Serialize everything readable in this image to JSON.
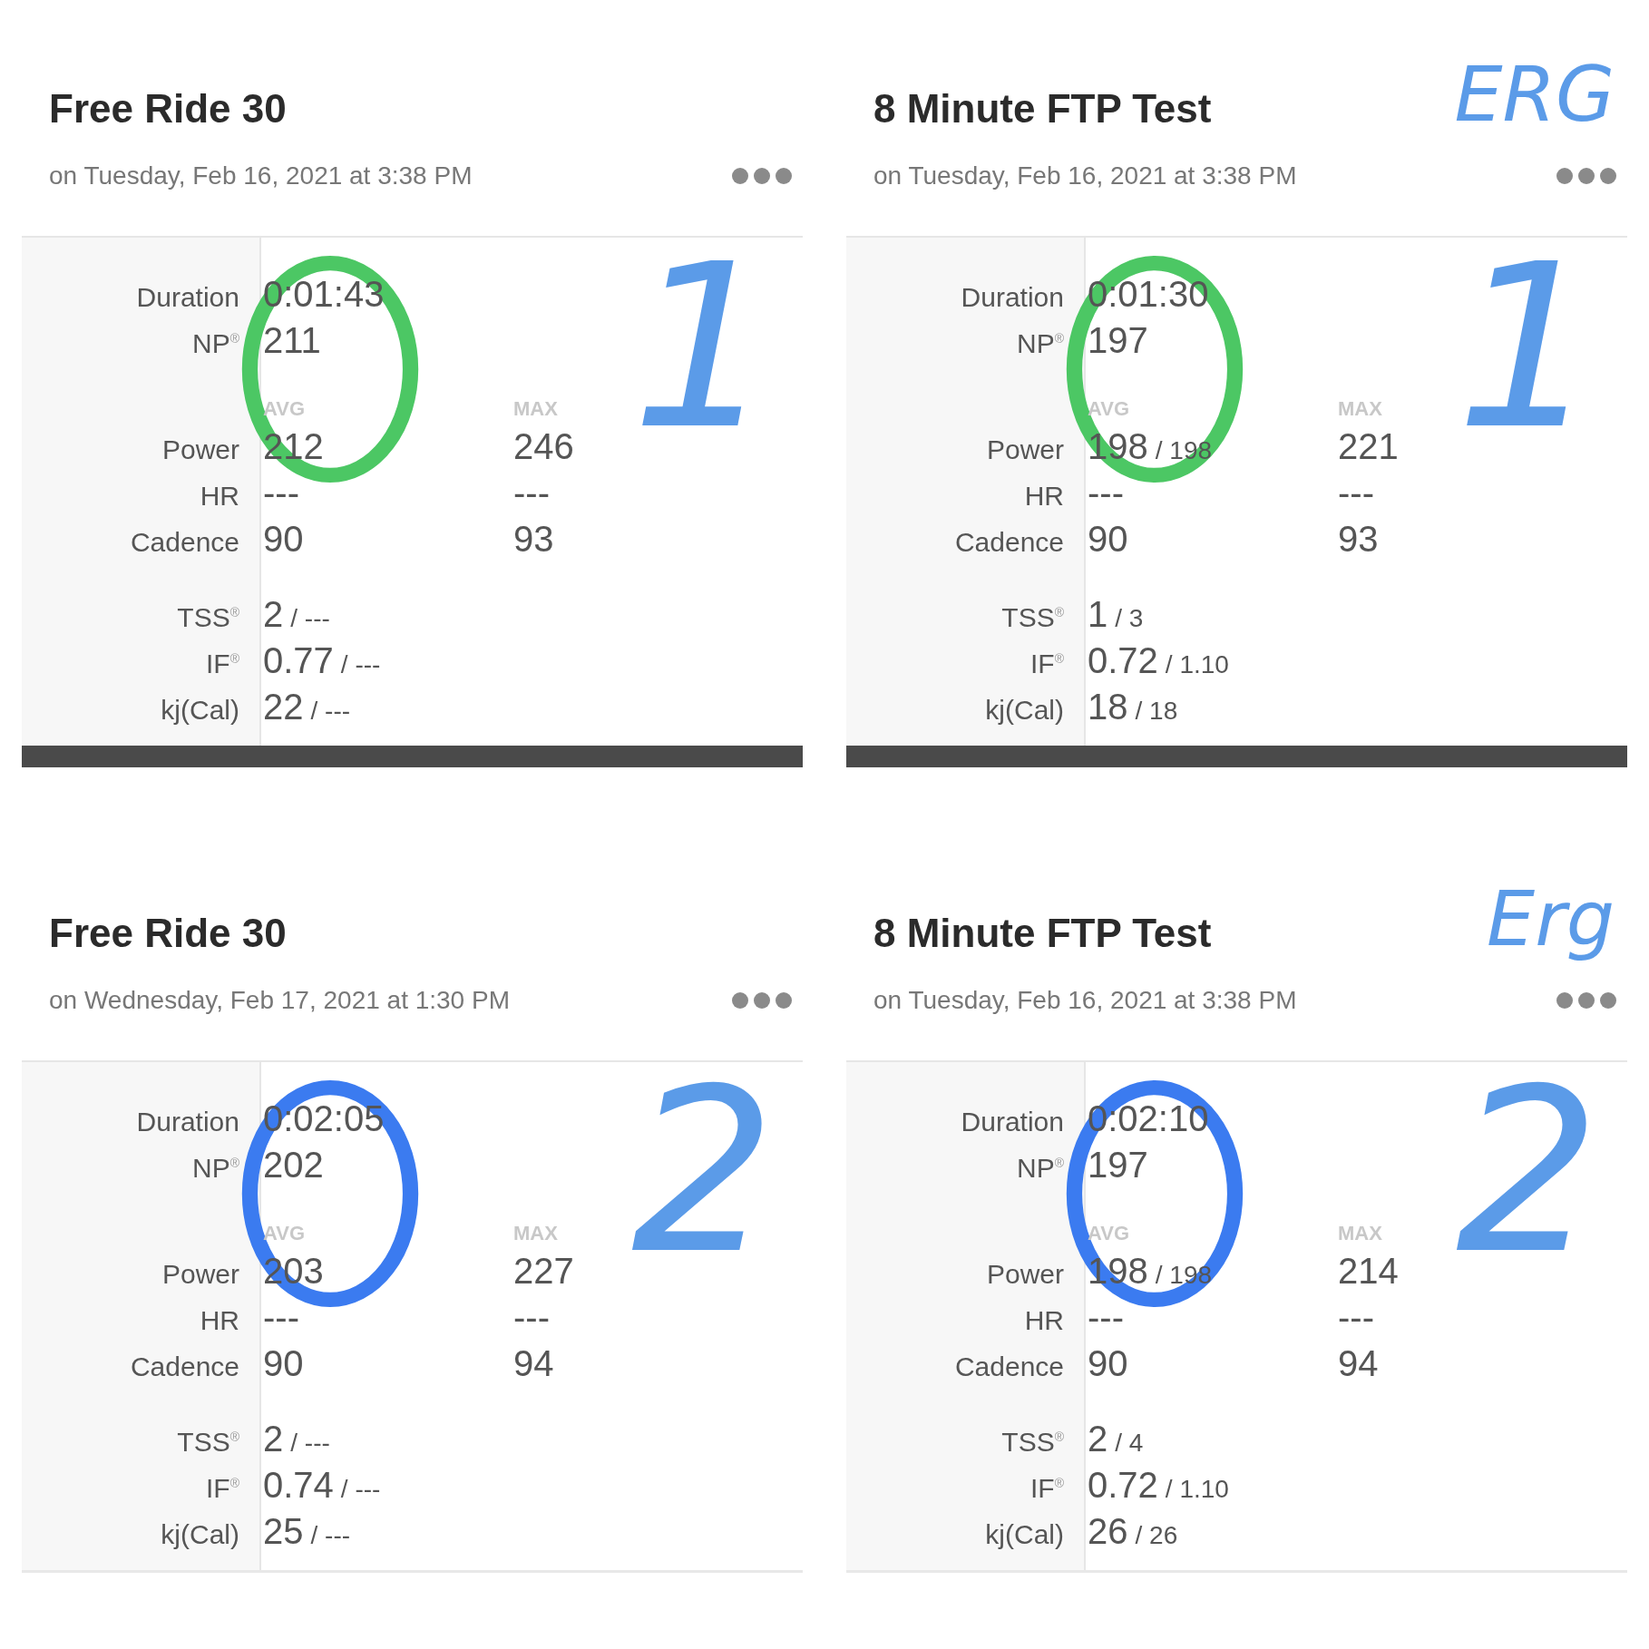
{
  "panels": [
    {
      "title": "Free Ride 30",
      "subtitle": "on Tuesday, Feb 16, 2021 at 3:38 PM",
      "divider": {
        "kind": "dark"
      },
      "circle": {
        "color": "#4cc764"
      },
      "notes": [
        {
          "kind": "number",
          "text": "1",
          "color": "#5b9be8"
        }
      ],
      "top_rows": [
        {
          "label": "Duration",
          "value": "0:01:43"
        },
        {
          "label": "NP$^{®}$",
          "value": "211"
        }
      ],
      "avg_header": "AVG",
      "max_header": "MAX",
      "mid_rows": [
        {
          "label": "Power",
          "avg": "212",
          "max": "246"
        },
        {
          "label": "HR",
          "avg": "---",
          "max": "---"
        },
        {
          "label": "Cadence",
          "avg": "90",
          "max": "93"
        }
      ],
      "bottom_rows": [
        {
          "label": "TSS$^{®}$",
          "value": "2",
          "extra": "/ ---"
        },
        {
          "label": "IF$^{®}$",
          "value": "0.77",
          "extra": "/ ---"
        },
        {
          "label": "kj(Cal)",
          "value": "22",
          "extra": "/ ---"
        }
      ]
    },
    {
      "title": "8 Minute FTP Test",
      "subtitle": "on Tuesday, Feb 16, 2021 at 3:38 PM",
      "divider": {
        "kind": "dark"
      },
      "circle": {
        "color": "#4cc764"
      },
      "notes": [
        {
          "kind": "word",
          "text": "ERG",
          "color": "#5b9be8"
        },
        {
          "kind": "number",
          "text": "1",
          "color": "#5b9be8"
        }
      ],
      "top_rows": [
        {
          "label": "Duration",
          "value": "0:01:30"
        },
        {
          "label": "NP$^{®}$",
          "value": "197"
        }
      ],
      "avg_header": "AVG",
      "max_header": "MAX",
      "mid_rows": [
        {
          "label": "Power",
          "avg": "198",
          "avg_extra": "/ 198",
          "max": "221"
        },
        {
          "label": "HR",
          "avg": "---",
          "max": "---"
        },
        {
          "label": "Cadence",
          "avg": "90",
          "max": "93"
        }
      ],
      "bottom_rows": [
        {
          "label": "TSS$^{®}$",
          "value": "1",
          "extra": "/ 3"
        },
        {
          "label": "IF$^{®}$",
          "value": "0.72",
          "extra": "/ 1.10"
        },
        {
          "label": "kj(Cal)",
          "value": "18",
          "extra": "/ 18"
        }
      ]
    },
    {
      "title": "Free Ride 30",
      "subtitle": "on Wednesday, Feb 17, 2021 at 1:30 PM",
      "divider": {
        "kind": "light"
      },
      "circle": {
        "color": "#3b7bf0"
      },
      "notes": [
        {
          "kind": "number",
          "text": "2",
          "color": "#5b9be8"
        }
      ],
      "top_rows": [
        {
          "label": "Duration",
          "value": "0:02:05"
        },
        {
          "label": "NP$^{®}$",
          "value": "202"
        }
      ],
      "avg_header": "AVG",
      "max_header": "MAX",
      "mid_rows": [
        {
          "label": "Power",
          "avg": "203",
          "max": "227"
        },
        {
          "label": "HR",
          "avg": "---",
          "max": "---"
        },
        {
          "label": "Cadence",
          "avg": "90",
          "max": "94"
        }
      ],
      "bottom_rows": [
        {
          "label": "TSS$^{®}$",
          "value": "2",
          "extra": "/ ---"
        },
        {
          "label": "IF$^{®}$",
          "value": "0.74",
          "extra": "/ ---"
        },
        {
          "label": "kj(Cal)",
          "value": "25",
          "extra": "/ ---"
        }
      ]
    },
    {
      "title": "8 Minute FTP Test",
      "subtitle": "on Tuesday, Feb 16, 2021 at 3:38 PM",
      "divider": {
        "kind": "light"
      },
      "circle": {
        "color": "#3b7bf0"
      },
      "notes": [
        {
          "kind": "word",
          "text": "Erg",
          "color": "#5b9be8"
        },
        {
          "kind": "number",
          "text": "2",
          "color": "#5b9be8"
        }
      ],
      "top_rows": [
        {
          "label": "Duration",
          "value": "0:02:10"
        },
        {
          "label": "NP$^{®}$",
          "value": "197"
        }
      ],
      "avg_header": "AVG",
      "max_header": "MAX",
      "mid_rows": [
        {
          "label": "Power",
          "avg": "198",
          "avg_extra": "/ 198",
          "max": "214"
        },
        {
          "label": "HR",
          "avg": "---",
          "max": "---"
        },
        {
          "label": "Cadence",
          "avg": "90",
          "max": "94"
        }
      ],
      "bottom_rows": [
        {
          "label": "TSS$^{®}$",
          "value": "2",
          "extra": "/ 4"
        },
        {
          "label": "IF$^{®}$",
          "value": "0.72",
          "extra": "/ 1.10"
        },
        {
          "label": "kj(Cal)",
          "value": "26",
          "extra": "/ 26"
        }
      ]
    }
  ]
}
